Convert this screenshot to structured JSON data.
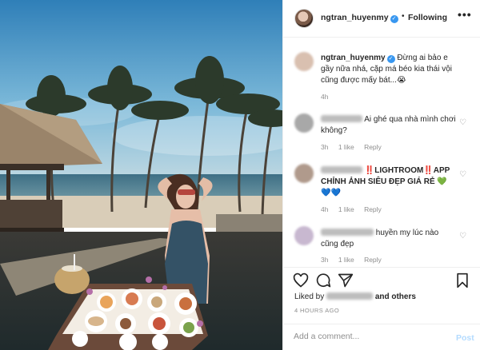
{
  "post": {
    "username": "ngtran_huyenmy",
    "verified_badge": "✓",
    "separator": "•",
    "follow_label": "Following",
    "more_icon": "more-icon"
  },
  "comments": [
    {
      "username": "ngtran_huyenmy",
      "text": "Đừng ai bảo e gầy nữa nhá, cặp má béo kia thái vội cũng được mấy bát...",
      "emoji": "😭",
      "age": "4h"
    },
    {
      "username_hidden": true,
      "text": "Ai ghé qua nhà mình chơi không?",
      "age": "3h",
      "likes": "1 like",
      "reply": "Reply"
    },
    {
      "username_hidden": true,
      "text": "‼️LIGHTROOM‼️APP CHỈNH ẢNH SIÊU ĐẸP GIÁ RẺ",
      "emoji_green": "💚",
      "emoji_blue": "💙💙",
      "age": "4h",
      "likes": "1 like",
      "reply": "Reply"
    },
    {
      "username_hidden": true,
      "text": "huyền my lúc nào cũng đẹp",
      "age": "3h",
      "likes": "1 like",
      "reply": "Reply"
    }
  ],
  "actions": {
    "liked_by_prefix": "Liked by",
    "liked_by_suffix": "and others",
    "timestamp": "4 HOURS AGO",
    "comment_placeholder": "Add a comment...",
    "post_label": "Post"
  },
  "colors": {
    "verified": "#3897f0",
    "post_disabled": "#b3dbff",
    "muted": "#8e8e8e"
  }
}
